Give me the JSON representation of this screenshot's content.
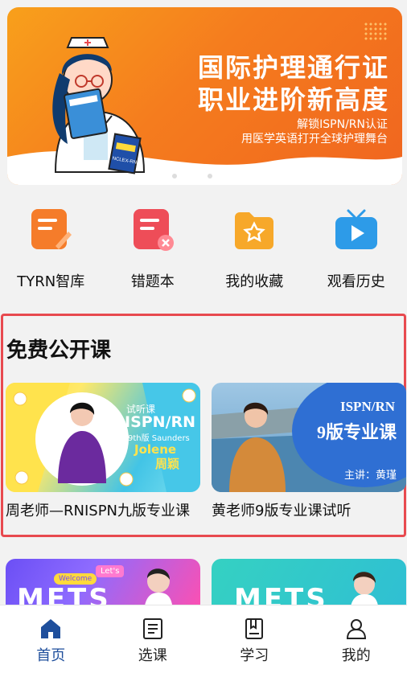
{
  "banner": {
    "headline_line1": "国际护理通行证",
    "headline_line2": "职业进阶新高度",
    "sub_line1": "解锁ISPN/RN认证",
    "sub_line2": "用医学英语打开全球护理舞台",
    "book_text": "NCLEX-RN",
    "slides": 3,
    "active_slide": 2
  },
  "quick_menu": [
    {
      "label": "TYRN智库",
      "icon": "knowledge-base-icon",
      "color": "#f57c2a"
    },
    {
      "label": "错题本",
      "icon": "wrong-questions-icon",
      "color": "#ee4d58"
    },
    {
      "label": "我的收藏",
      "icon": "favorites-folder-icon",
      "color": "#f7a82a"
    },
    {
      "label": "观看历史",
      "icon": "watch-history-tv-icon",
      "color": "#2d9be8"
    }
  ],
  "free_courses": {
    "title": "免费公开课",
    "items": [
      {
        "title": "周老师—RNISPN九版专业课",
        "thumb": {
          "tag": "试听课",
          "line1": "ISPN/RN",
          "line2": "9th版 Saunders",
          "name_en": "Jolene",
          "name_cn": "周颖"
        }
      },
      {
        "title": "黄老师9版专业课试听",
        "thumb": {
          "line1": "ISPN/RN",
          "line2": "9版专业课",
          "teacher": "主讲：黄瑾"
        }
      }
    ]
  },
  "more_courses": [
    {
      "tag1": "Welcome",
      "tag2": "Let's",
      "brand": "METS"
    },
    {
      "brand": "METS"
    }
  ],
  "tabbar": [
    {
      "label": "首页",
      "icon": "home-icon",
      "active": true
    },
    {
      "label": "选课",
      "icon": "course-list-icon",
      "active": false
    },
    {
      "label": "学习",
      "icon": "study-book-icon",
      "active": false
    },
    {
      "label": "我的",
      "icon": "profile-icon",
      "active": false
    }
  ],
  "colors": {
    "accent": "#1f4f9c",
    "banner": "#f57c1e",
    "highlight_border": "#e84a4f"
  }
}
